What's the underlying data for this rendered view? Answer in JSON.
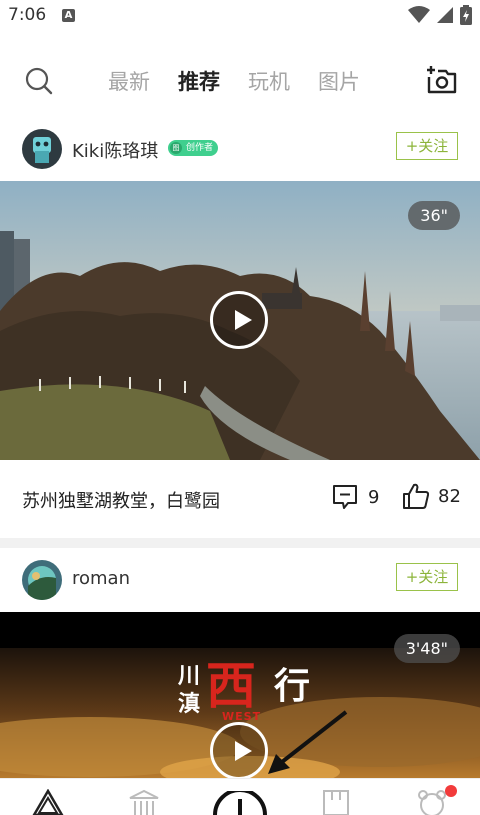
{
  "status": {
    "time": "7:06",
    "notification_icon": "A"
  },
  "header": {
    "search_icon": "search-icon",
    "tabs": [
      {
        "label": "最新",
        "active": false
      },
      {
        "label": "推荐",
        "active": true
      },
      {
        "label": "玩机",
        "active": false
      },
      {
        "label": "图片",
        "active": false
      }
    ],
    "camera_icon": "camera-add-icon"
  },
  "posts": [
    {
      "author": "Kiki陈珞琪",
      "badge": "创作者",
      "badge_icon_text": "图",
      "follow_label": "+关注",
      "duration": "36\"",
      "caption": "苏州独墅湖教堂，白鹭园",
      "comments": "9",
      "likes": "82"
    },
    {
      "author": "roman",
      "follow_label": "+关注",
      "duration": "3'48\"",
      "title_left": "川\n滇",
      "title_main": "西",
      "title_right": "行",
      "title_sub": "WEST"
    }
  ],
  "colors": {
    "accent_green": "#8cb43a",
    "badge_green": "#3fcf8e",
    "red_dot": "#f23b3b"
  },
  "bottom_nav": {
    "items": [
      "home-triangle-icon",
      "temple-icon",
      "publish-icon",
      "frame-icon",
      "profile-icon"
    ],
    "profile_has_notification": true
  }
}
